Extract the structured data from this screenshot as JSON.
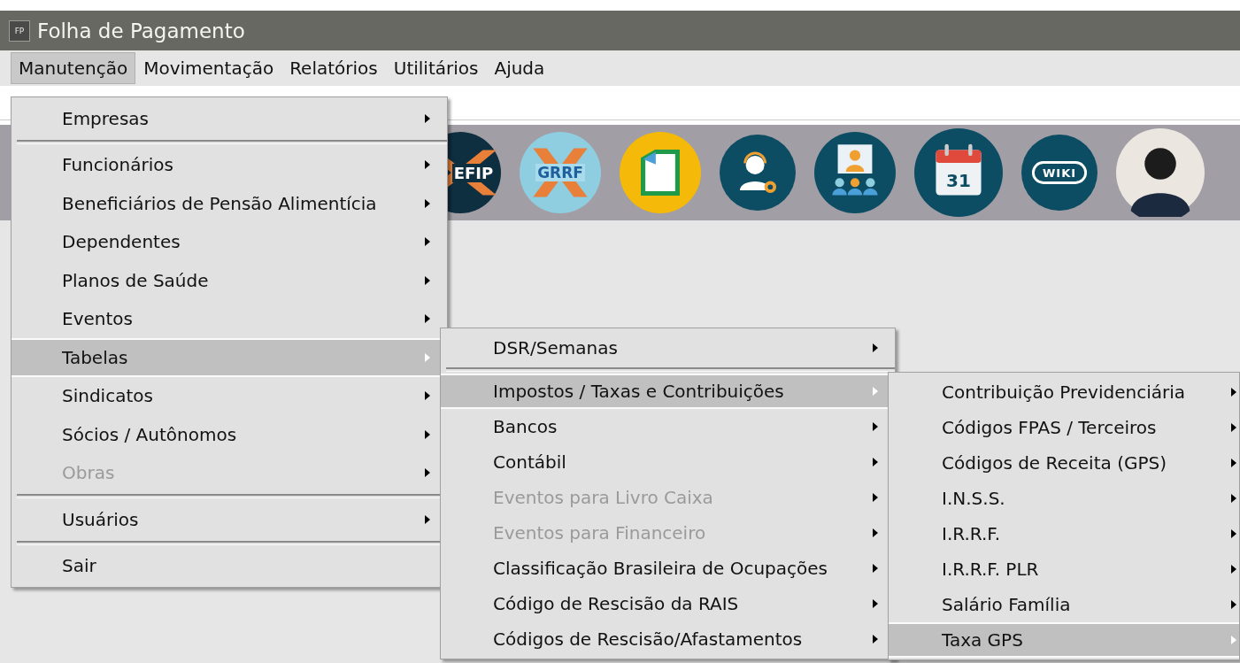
{
  "window": {
    "title": "Folha de Pagamento",
    "icon_label": "FP"
  },
  "menu_bar": [
    {
      "label": "Manutenção",
      "selected": true
    },
    {
      "label": "Movimentação",
      "selected": false
    },
    {
      "label": "Relatórios",
      "selected": false
    },
    {
      "label": "Utilitários",
      "selected": false
    },
    {
      "label": "Ajuda",
      "selected": false
    }
  ],
  "toolbar": [
    {
      "kind": "sefip",
      "label": "EFIP"
    },
    {
      "kind": "grrf",
      "label": "GRRF"
    },
    {
      "kind": "document"
    },
    {
      "kind": "support"
    },
    {
      "kind": "meeting"
    },
    {
      "kind": "calendar",
      "label": "31"
    },
    {
      "kind": "wiki",
      "label": "WIKI"
    },
    {
      "kind": "avatar"
    }
  ],
  "menus": [
    {
      "items": [
        {
          "kind": "item",
          "label": "Empresas",
          "submenu": true,
          "disabled": false,
          "selected": false
        },
        {
          "kind": "separator"
        },
        {
          "kind": "item",
          "label": "Funcionários",
          "submenu": true,
          "disabled": false,
          "selected": false
        },
        {
          "kind": "item",
          "label": "Beneficiários de Pensão Alimentícia",
          "submenu": true,
          "disabled": false,
          "selected": false
        },
        {
          "kind": "item",
          "label": "Dependentes",
          "submenu": true,
          "disabled": false,
          "selected": false
        },
        {
          "kind": "item",
          "label": "Planos de Saúde",
          "submenu": true,
          "disabled": false,
          "selected": false
        },
        {
          "kind": "item",
          "label": "Eventos",
          "submenu": true,
          "disabled": false,
          "selected": false
        },
        {
          "kind": "item",
          "label": "Tabelas",
          "submenu": true,
          "disabled": false,
          "selected": true
        },
        {
          "kind": "item",
          "label": "Sindicatos",
          "submenu": true,
          "disabled": false,
          "selected": false
        },
        {
          "kind": "item",
          "label": "Sócios / Autônomos",
          "submenu": true,
          "disabled": false,
          "selected": false
        },
        {
          "kind": "item",
          "label": "Obras",
          "submenu": true,
          "disabled": true,
          "selected": false
        },
        {
          "kind": "separator"
        },
        {
          "kind": "item",
          "label": "Usuários",
          "submenu": true,
          "disabled": false,
          "selected": false
        },
        {
          "kind": "separator"
        },
        {
          "kind": "item",
          "label": "Sair",
          "submenu": false,
          "disabled": false,
          "selected": false
        }
      ]
    },
    {
      "items": [
        {
          "kind": "item",
          "label": "DSR/Semanas",
          "submenu": true,
          "disabled": false,
          "selected": false
        },
        {
          "kind": "separator"
        },
        {
          "kind": "item",
          "label": "Impostos / Taxas e Contribuições",
          "submenu": true,
          "disabled": false,
          "selected": true
        },
        {
          "kind": "item",
          "label": "Bancos",
          "submenu": true,
          "disabled": false,
          "selected": false
        },
        {
          "kind": "item",
          "label": "Contábil",
          "submenu": true,
          "disabled": false,
          "selected": false
        },
        {
          "kind": "item",
          "label": "Eventos para Livro Caixa",
          "submenu": true,
          "disabled": true,
          "selected": false
        },
        {
          "kind": "item",
          "label": "Eventos para Financeiro",
          "submenu": true,
          "disabled": true,
          "selected": false
        },
        {
          "kind": "item",
          "label": "Classificação Brasileira de Ocupações",
          "submenu": true,
          "disabled": false,
          "selected": false
        },
        {
          "kind": "item",
          "label": "Código de Rescisão da RAIS",
          "submenu": true,
          "disabled": false,
          "selected": false
        },
        {
          "kind": "item",
          "label": "Códigos de Rescisão/Afastamentos",
          "submenu": true,
          "disabled": false,
          "selected": false
        }
      ]
    },
    {
      "items": [
        {
          "kind": "item",
          "label": "Contribuição Previdenciária",
          "submenu": true,
          "disabled": false,
          "selected": false
        },
        {
          "kind": "item",
          "label": "Códigos FPAS / Terceiros",
          "submenu": true,
          "disabled": false,
          "selected": false
        },
        {
          "kind": "item",
          "label": "Códigos de Receita (GPS)",
          "submenu": true,
          "disabled": false,
          "selected": false
        },
        {
          "kind": "item",
          "label": "I.N.S.S.",
          "submenu": true,
          "disabled": false,
          "selected": false
        },
        {
          "kind": "item",
          "label": "I.R.R.F.",
          "submenu": true,
          "disabled": false,
          "selected": false
        },
        {
          "kind": "item",
          "label": "I.R.R.F. PLR",
          "submenu": true,
          "disabled": false,
          "selected": false
        },
        {
          "kind": "item",
          "label": "Salário Família",
          "submenu": true,
          "disabled": false,
          "selected": false
        },
        {
          "kind": "item",
          "label": "Taxa GPS",
          "submenu": true,
          "disabled": false,
          "selected": true
        }
      ]
    }
  ]
}
